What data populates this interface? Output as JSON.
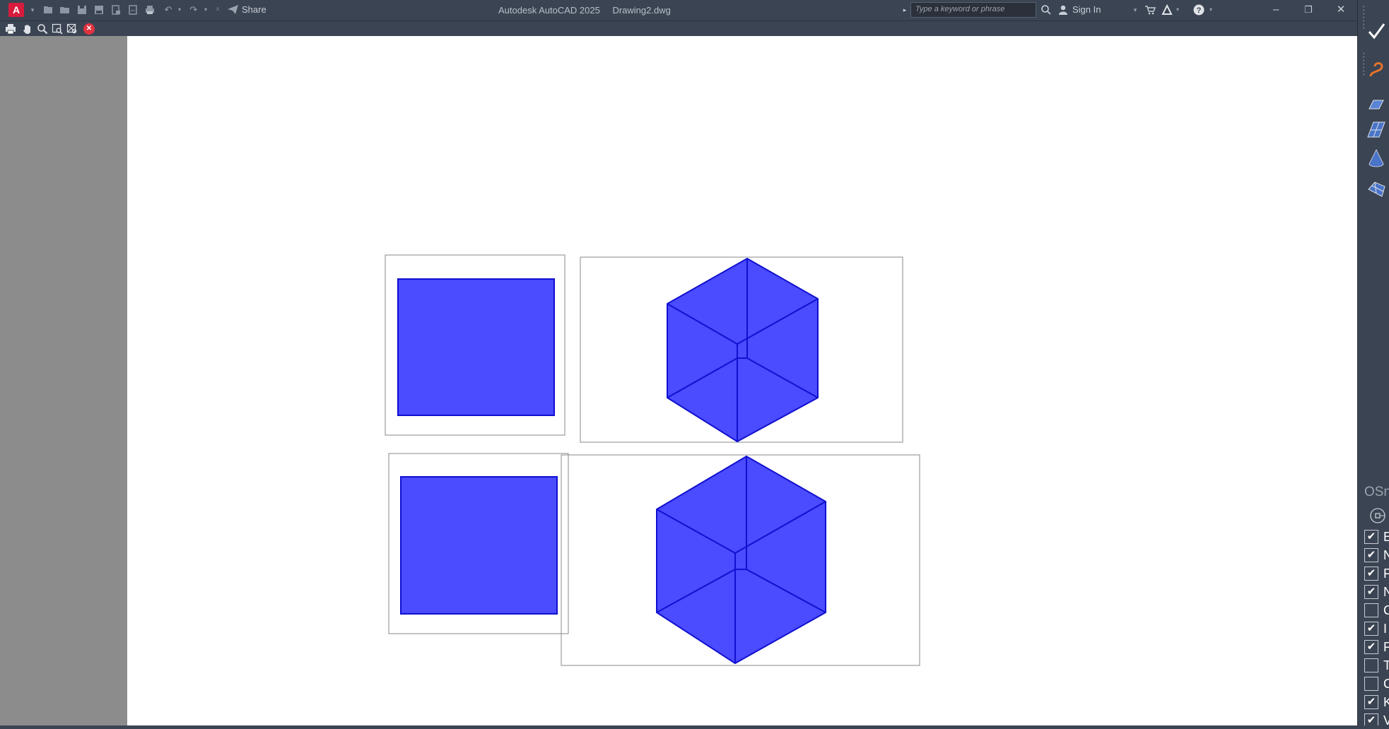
{
  "app": {
    "logo_letter": "A",
    "title": "Autodesk AutoCAD 2025",
    "document": "Drawing2.dwg"
  },
  "quick_access": {
    "share_label": "Share"
  },
  "search": {
    "placeholder": "Type a keyword or phrase"
  },
  "account": {
    "sign_in_label": "Sign In"
  },
  "window_controls": {
    "minimize": "–",
    "restore": "❐",
    "close": "✕"
  },
  "toolbar2": {
    "items": [
      "print-icon",
      "pan-hand-icon",
      "zoom-icon",
      "zoom-window-icon",
      "zoom-extents-icon",
      "close-preview-icon"
    ]
  },
  "drawing": {
    "fill_color": "#4b4bff",
    "stroke_color": "#1010d0",
    "viewport_border": "#8a8a8a"
  },
  "osnap": {
    "title": "OSn",
    "items": [
      {
        "letter": "E",
        "checked": true
      },
      {
        "letter": "N",
        "checked": true
      },
      {
        "letter": "F",
        "checked": true
      },
      {
        "letter": "N",
        "checked": true
      },
      {
        "letter": "C",
        "checked": false
      },
      {
        "letter": "I",
        "checked": true
      },
      {
        "letter": "F",
        "checked": true
      },
      {
        "letter": "T",
        "checked": false
      },
      {
        "letter": "C",
        "checked": false
      },
      {
        "letter": "K",
        "checked": true
      },
      {
        "letter": "V",
        "checked": true
      }
    ]
  }
}
